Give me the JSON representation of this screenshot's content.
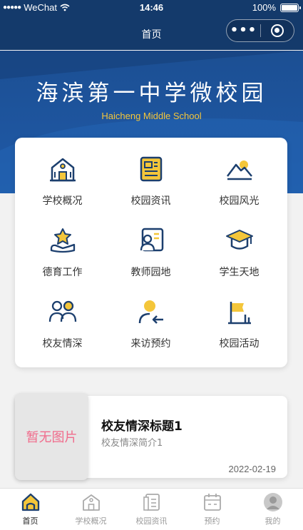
{
  "status_bar": {
    "carrier": "WeChat",
    "time": "14:46",
    "battery": "100%",
    "battery_level": 1.0
  },
  "nav": {
    "title": "首页",
    "more_icon": "more-dots-icon",
    "close_icon": "close-target-icon"
  },
  "banner": {
    "title_cn": "海滨第一中学微校园",
    "title_en": "Haicheng Middle School"
  },
  "grid": [
    {
      "label": "学校概况",
      "icon": "school-building-icon"
    },
    {
      "label": "校园资讯",
      "icon": "newspaper-icon"
    },
    {
      "label": "校园风光",
      "icon": "landscape-icon"
    },
    {
      "label": "德育工作",
      "icon": "star-hand-icon"
    },
    {
      "label": "教师园地",
      "icon": "teacher-board-icon"
    },
    {
      "label": "学生天地",
      "icon": "graduation-cap-icon"
    },
    {
      "label": "校友情深",
      "icon": "alumni-people-icon"
    },
    {
      "label": "来访预约",
      "icon": "visitor-icon"
    },
    {
      "label": "校园活动",
      "icon": "flag-icon"
    }
  ],
  "news": {
    "thumb_placeholder": "暂无图片",
    "title": "校友情深标题1",
    "summary": "校友情深简介1",
    "date": "2022-02-19"
  },
  "tabbar": [
    {
      "label": "首页",
      "icon": "home-icon",
      "active": true
    },
    {
      "label": "学校概况",
      "icon": "school-building-icon",
      "active": false
    },
    {
      "label": "校园资讯",
      "icon": "document-icon",
      "active": false
    },
    {
      "label": "预约",
      "icon": "calendar-icon",
      "active": false
    },
    {
      "label": "我的",
      "icon": "user-avatar-icon",
      "active": false
    }
  ],
  "colors": {
    "brand_blue": "#143a6b",
    "banner_blue": "#1f5aa8",
    "accent_yellow": "#f4c63a",
    "icon_navy": "#1c3f6e",
    "placeholder_pink": "#f06c8c"
  }
}
